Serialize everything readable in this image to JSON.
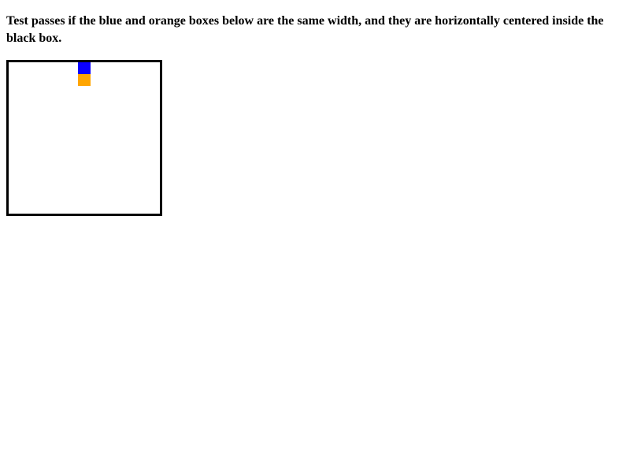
{
  "instructions": {
    "text": "Test passes if the blue and orange boxes below are the same width, and they are horizontally centered inside the black box."
  },
  "colors": {
    "blue": "#0b00ff",
    "orange": "#ffa500",
    "border": "#000000",
    "background": "#ffffff"
  }
}
